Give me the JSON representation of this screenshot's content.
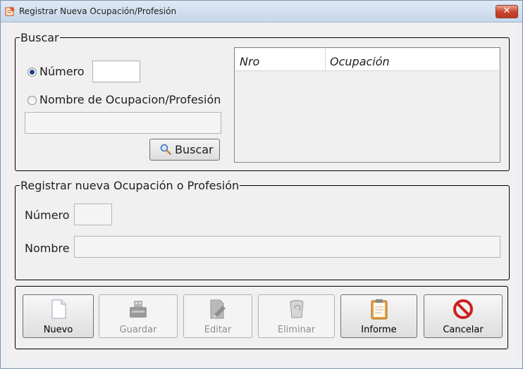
{
  "window": {
    "title": "Registrar Nueva Ocupación/Profesión",
    "close_label": "✕"
  },
  "search": {
    "group_title": "Buscar",
    "radio_numero": "Número",
    "radio_nombre": "Nombre de Ocupacion/Profesión",
    "numero_value": "",
    "nombre_value": "",
    "button_label": "Buscar",
    "grid_columns": [
      "Nro",
      "Ocupación"
    ],
    "grid_rows": []
  },
  "register": {
    "group_title": "Registrar nueva Ocupación o Profesión",
    "numero_label": "Número",
    "numero_value": "",
    "nombre_label": "Nombre",
    "nombre_value": ""
  },
  "toolbar": {
    "nuevo": "Nuevo",
    "guardar": "Guardar",
    "editar": "Editar",
    "eliminar": "Eliminar",
    "informe": "Informe",
    "cancelar": "Cancelar"
  },
  "icons": {
    "window": "register-form-icon",
    "search": "magnifier-icon",
    "nuevo": "blank-document-icon",
    "guardar": "usb-drive-icon",
    "editar": "edit-document-icon",
    "eliminar": "trash-can-icon",
    "informe": "clipboard-icon",
    "cancelar": "no-entry-icon"
  },
  "colors": {
    "cancel_red": "#cc1f1f",
    "informe_orange": "#e8a24a",
    "radio_dot": "#1f3f8f"
  }
}
